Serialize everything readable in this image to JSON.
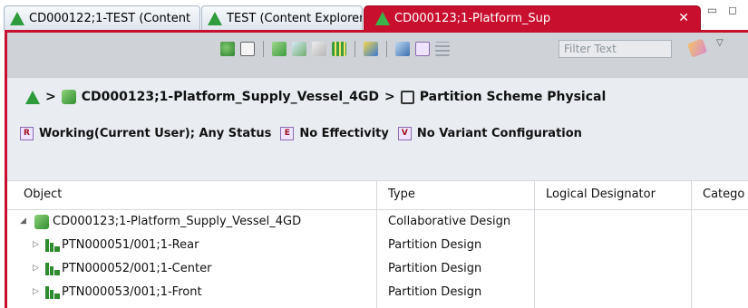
{
  "tabs": [
    {
      "label": "CD000122;1-TEST (Content",
      "active": false
    },
    {
      "label": "TEST (Content Explorer)",
      "active": false
    },
    {
      "label": "CD000123;1-Platform_Sup",
      "active": true
    }
  ],
  "tab_close_glyph": "✕",
  "window_controls": "▭ ◻",
  "toolbar": {
    "filter_placeholder": "Filter Text",
    "dropdown_glyph": "▽"
  },
  "breadcrumb": {
    "separator": ">",
    "object": "CD000123;1-Platform_Supply_Vessel_4GD",
    "view": "Partition Scheme Physical"
  },
  "config": {
    "revision_rule": "Working(Current User); Any Status",
    "effectivity": "No Effectivity",
    "variant": "No Variant Configuration",
    "revision_rule_icon_letter": "R",
    "effectivity_icon_letter": "E",
    "variant_icon_letter": "V"
  },
  "table": {
    "columns": [
      "Object",
      "Type",
      "Logical Designator",
      "Catego"
    ],
    "rows": [
      {
        "object": "CD000123;1-Platform_Supply_Vessel_4GD",
        "type": "Collaborative Design",
        "expander": "◢",
        "icon": "cube-icon"
      },
      {
        "object": "PTN000051/001;1-Rear",
        "type": "Partition Design",
        "expander": "▷",
        "icon": "partition-icon"
      },
      {
        "object": "PTN000052/001;1-Center",
        "type": "Partition Design",
        "expander": "▷",
        "icon": "partition-icon"
      },
      {
        "object": "PTN000053/001;1-Front",
        "type": "Partition Design",
        "expander": "▷",
        "icon": "partition-icon"
      }
    ]
  },
  "colors": {
    "active_tab": "#c8102e",
    "accent_green": "#2e9b3c",
    "toolbar_bg": "#cfd3d8",
    "header_bg": "#e9edf1"
  }
}
